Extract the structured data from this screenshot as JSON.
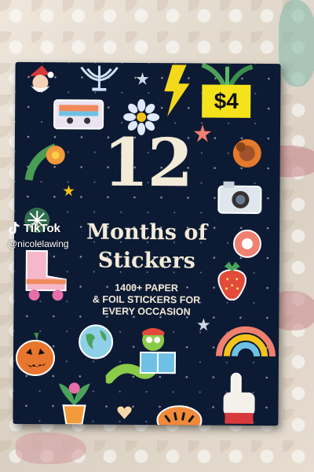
{
  "cover": {
    "price": "$4",
    "number": "12",
    "title_line1": "Months of",
    "title_line2": "Stickers",
    "subtitle_line1": "1400+ PAPER",
    "subtitle_line2": "& FOIL STICKERS FOR",
    "subtitle_line3": "EVERY OCCASION"
  },
  "watermark": {
    "app": "TikTok",
    "handle": "@nicolelawing"
  },
  "colors": {
    "cover_bg": "#0c1a33",
    "price_tag": "#f4e31a",
    "cover_text": "#f3ead8"
  }
}
